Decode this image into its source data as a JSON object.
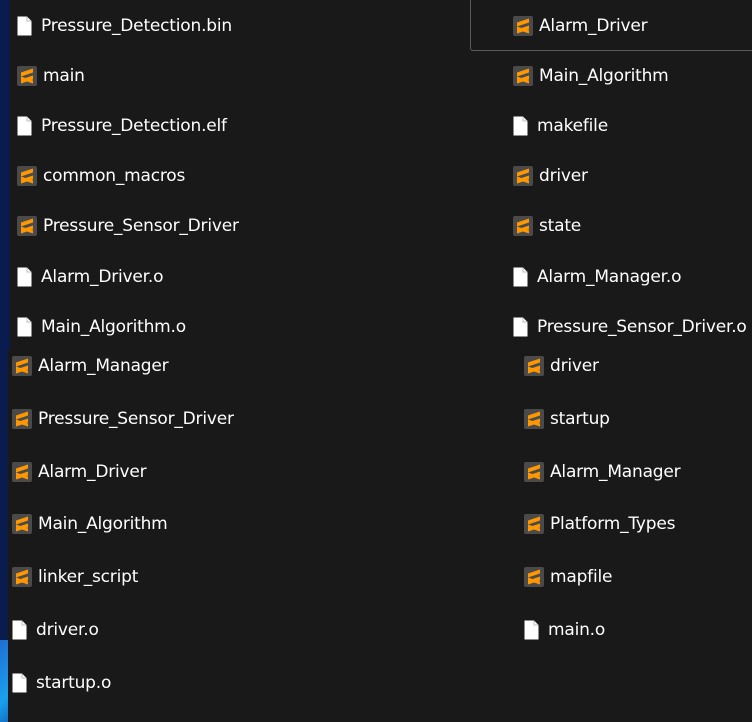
{
  "left_top": [
    {
      "label": "Pressure_Detection.bin",
      "icon": "file-icon"
    },
    {
      "label": "main",
      "icon": "sublime-file-icon"
    },
    {
      "label": "Pressure_Detection.elf",
      "icon": "file-icon"
    },
    {
      "label": "common_macros",
      "icon": "sublime-file-icon"
    },
    {
      "label": "Pressure_Sensor_Driver",
      "icon": "sublime-file-icon"
    },
    {
      "label": "Alarm_Driver.o",
      "icon": "file-icon"
    },
    {
      "label": "Main_Algorithm.o",
      "icon": "file-icon"
    }
  ],
  "right_top": [
    {
      "label": "Alarm_Driver",
      "icon": "sublime-file-icon"
    },
    {
      "label": "Main_Algorithm",
      "icon": "sublime-file-icon"
    },
    {
      "label": "makefile",
      "icon": "file-icon"
    },
    {
      "label": "driver",
      "icon": "sublime-file-icon"
    },
    {
      "label": "state",
      "icon": "sublime-file-icon"
    },
    {
      "label": "Alarm_Manager.o",
      "icon": "file-icon"
    },
    {
      "label": "Pressure_Sensor_Driver.o",
      "icon": "file-icon"
    }
  ],
  "left_bottom": [
    {
      "label": "Alarm_Manager",
      "icon": "sublime-file-icon"
    },
    {
      "label": "Pressure_Sensor_Driver",
      "icon": "sublime-file-icon"
    },
    {
      "label": "Alarm_Driver",
      "icon": "sublime-file-icon"
    },
    {
      "label": "Main_Algorithm",
      "icon": "sublime-file-icon"
    },
    {
      "label": "linker_script",
      "icon": "sublime-file-icon"
    },
    {
      "label": "driver.o",
      "icon": "file-icon"
    },
    {
      "label": "startup.o",
      "icon": "file-icon"
    }
  ],
  "right_bottom": [
    {
      "label": "driver",
      "icon": "sublime-file-icon"
    },
    {
      "label": "startup",
      "icon": "sublime-file-icon"
    },
    {
      "label": "Alarm_Manager",
      "icon": "sublime-file-icon"
    },
    {
      "label": "Platform_Types",
      "icon": "sublime-file-icon"
    },
    {
      "label": "mapfile",
      "icon": "sublime-file-icon"
    },
    {
      "label": "main.o",
      "icon": "file-icon"
    }
  ],
  "colors": {
    "background": "#0a1b4d",
    "panel": "#191919",
    "text": "#ffffff",
    "sublime_icon_bg": "#4a4a4a",
    "sublime_icon_accent": "#ff9800",
    "file_icon": "#ffffff"
  }
}
